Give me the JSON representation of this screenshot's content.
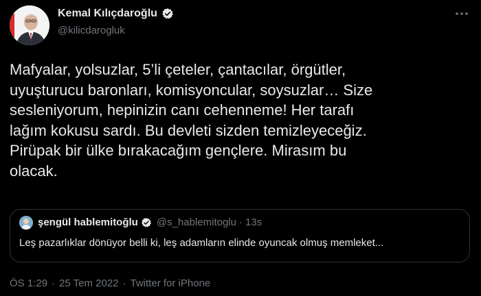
{
  "tweet": {
    "author_name": "Kemal Kılıçdaroğlu",
    "author_handle": "@kilicdarogluk",
    "more_icon": "more-dots-icon",
    "verified_icon": "verified-badge-icon",
    "verified_color": "#ffffff",
    "text": "Mafyalar, yolsuzlar, 5’li çeteler, çantacılar, örgütler,\nuyuşturucu baronları, komisyoncular, soysuzlar… Size\nsesleniyorum, hepinizin canı cehenneme! Her tarafı\nlağım kokusu sardı. Bu devleti sizden temizleyeceğiz.\nPirüpak bir ülke bırakacağım gençlere. Mirasım bu\nolacak.",
    "time": "ÖS 1:29",
    "date": "25 Tem 2022",
    "source": "Twitter for iPhone",
    "dot": "·"
  },
  "quote": {
    "author_name": "şengül hablemitoğlu",
    "author_handle": "@s_hablemitoglu",
    "dot": "·",
    "time": "13s",
    "text": "Leş pazarlıklar dönüyor belli ki, leş adamların elinde oyuncak olmuş memleket..."
  },
  "colors": {
    "background": "#000000",
    "text": "#e7e9ea",
    "muted": "#71767b",
    "border": "#2f3336"
  }
}
